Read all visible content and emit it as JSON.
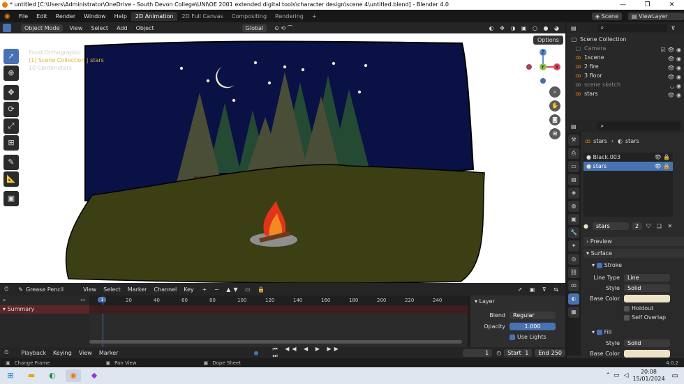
{
  "window": {
    "title": "* untitled [C:\\Users\\Administrator\\OneDrive - South Devon College\\UNI\\OE 2001 extended digital tools\\character design\\scene 4\\untitled.blend] - Blender 4.0",
    "controls": [
      "—",
      "❐",
      "✕"
    ]
  },
  "menu": [
    "File",
    "Edit",
    "Render",
    "Window",
    "Help"
  ],
  "workspaces": [
    "2D Animation",
    "2D Full Canvas",
    "Compositing",
    "Rendering",
    "+"
  ],
  "scene": {
    "label": "Scene",
    "viewlayer": "ViewLayer"
  },
  "viewport_header": {
    "mode": "Object Mode",
    "menus": [
      "View",
      "Select",
      "Add",
      "Object"
    ],
    "orientation": "Global"
  },
  "viewport_info": {
    "line1": "Front Orthographic",
    "line2": "(1) Scene Collection | stars",
    "line3": "10 Centimeters"
  },
  "options_label": "Options",
  "gizmo": {
    "z": "Z",
    "y": "Y",
    "x": "X"
  },
  "timeline_header": {
    "mode": "Grease Pencil",
    "menus": [
      "View",
      "Select",
      "Marker",
      "Channel",
      "Key"
    ]
  },
  "timeline": {
    "ticks": [
      "20",
      "40",
      "60",
      "80",
      "100",
      "120",
      "140",
      "160",
      "180",
      "200",
      "220",
      "240"
    ],
    "current_frame": "1",
    "summary": "Summary"
  },
  "layer_panel": {
    "title": "Layer",
    "blend_label": "Blend",
    "blend_value": "Regular",
    "opacity_label": "Opacity",
    "opacity_value": "1.000",
    "use_lights": "Use Lights"
  },
  "playback": {
    "menus": [
      "Playback",
      "Keying",
      "View",
      "Marker"
    ],
    "frame": "1",
    "start_label": "Start",
    "start": "1",
    "end_label": "End",
    "end": "250"
  },
  "status": {
    "left": "Change Frame",
    "middle": "Pan View",
    "right": "Dope Sheet",
    "version": "4.0.2"
  },
  "outliner": {
    "root": "Scene Collection",
    "items": [
      "Camera",
      "1scene",
      "2 fire",
      "3 floor",
      "scene sketch",
      "stars"
    ]
  },
  "properties": {
    "breadcrumb_a": "stars",
    "breadcrumb_b": "stars",
    "materials": [
      "Black.003",
      "stars"
    ],
    "material_name": "stars",
    "users": "2",
    "preview": "Preview",
    "surface": "Surface",
    "stroke": "Stroke",
    "line_type_label": "Line Type",
    "line_type": "Line",
    "style_label": "Style",
    "style": "Solid",
    "base_color_label": "Base Color",
    "holdout": "Holdout",
    "self_overlap": "Self Overlap",
    "fill": "Fill",
    "fill_style": "Solid",
    "fill_base_color_label": "Base Color"
  },
  "taskbar": {
    "time": "20:08",
    "date": "15/01/2024"
  },
  "colors": {
    "sky": "#0a1145",
    "grass": "#3c3f14",
    "accent": "#4772b3",
    "selected_orange": "#e0b63f"
  }
}
